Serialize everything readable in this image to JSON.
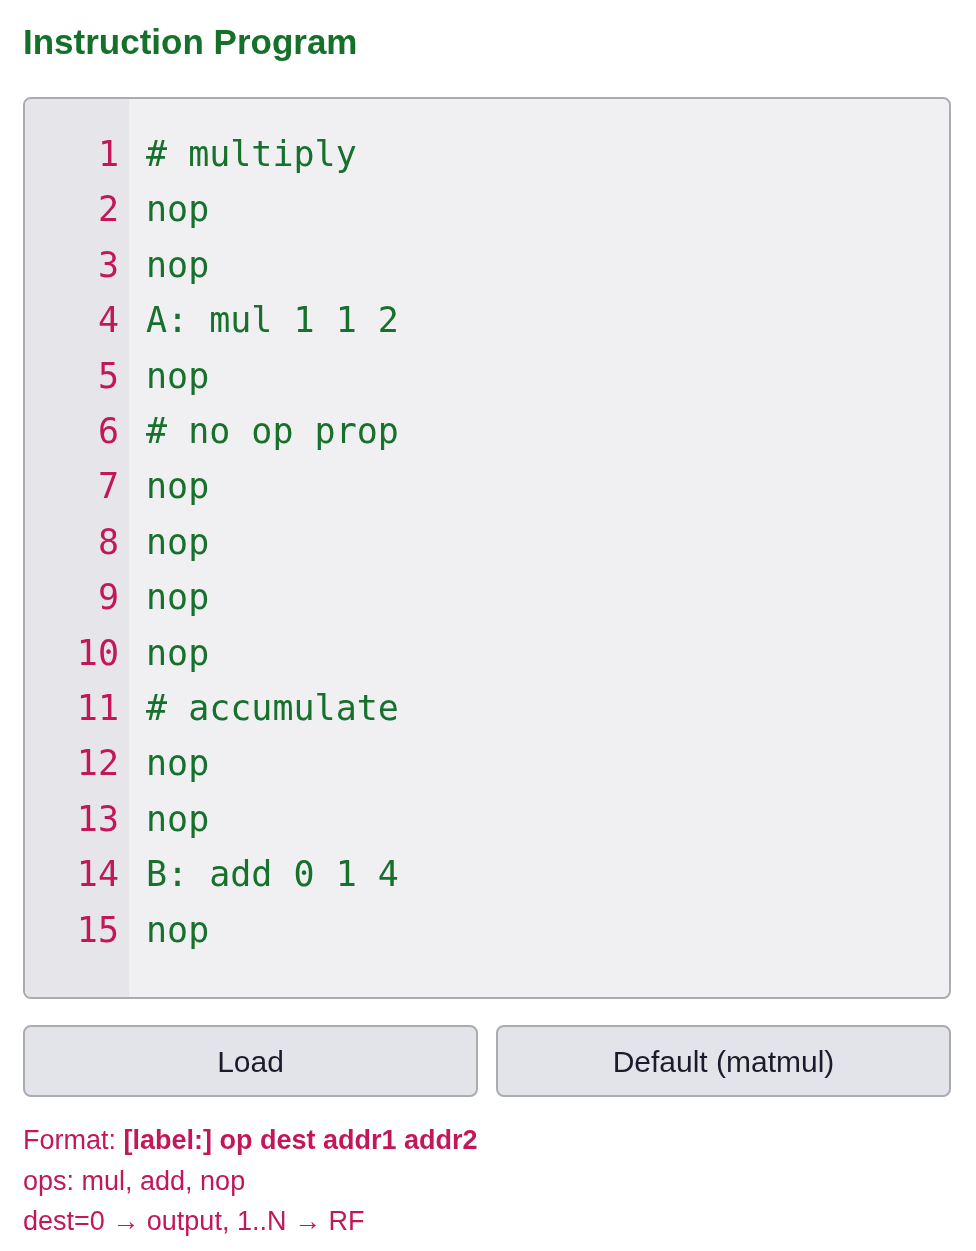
{
  "title": "Instruction Program",
  "editor": {
    "lines": [
      {
        "number": "1",
        "code": "# multiply"
      },
      {
        "number": "2",
        "code": "nop"
      },
      {
        "number": "3",
        "code": "nop"
      },
      {
        "number": "4",
        "code": "A: mul 1 1 2"
      },
      {
        "number": "5",
        "code": "nop"
      },
      {
        "number": "6",
        "code": "# no op prop"
      },
      {
        "number": "7",
        "code": "nop"
      },
      {
        "number": "8",
        "code": "nop"
      },
      {
        "number": "9",
        "code": "nop"
      },
      {
        "number": "10",
        "code": "nop"
      },
      {
        "number": "11",
        "code": "# accumulate"
      },
      {
        "number": "12",
        "code": "nop"
      },
      {
        "number": "13",
        "code": "nop"
      },
      {
        "number": "14",
        "code": "B: add 0 1 4"
      },
      {
        "number": "15",
        "code": "nop"
      }
    ]
  },
  "buttons": [
    "Load",
    "Default (matmul)"
  ],
  "help": [
    "Format: **[label:] op dest addr1 addr2**",
    "ops: mul, add, nop",
    "dest=0 → output, 1..N → RF"
  ]
}
